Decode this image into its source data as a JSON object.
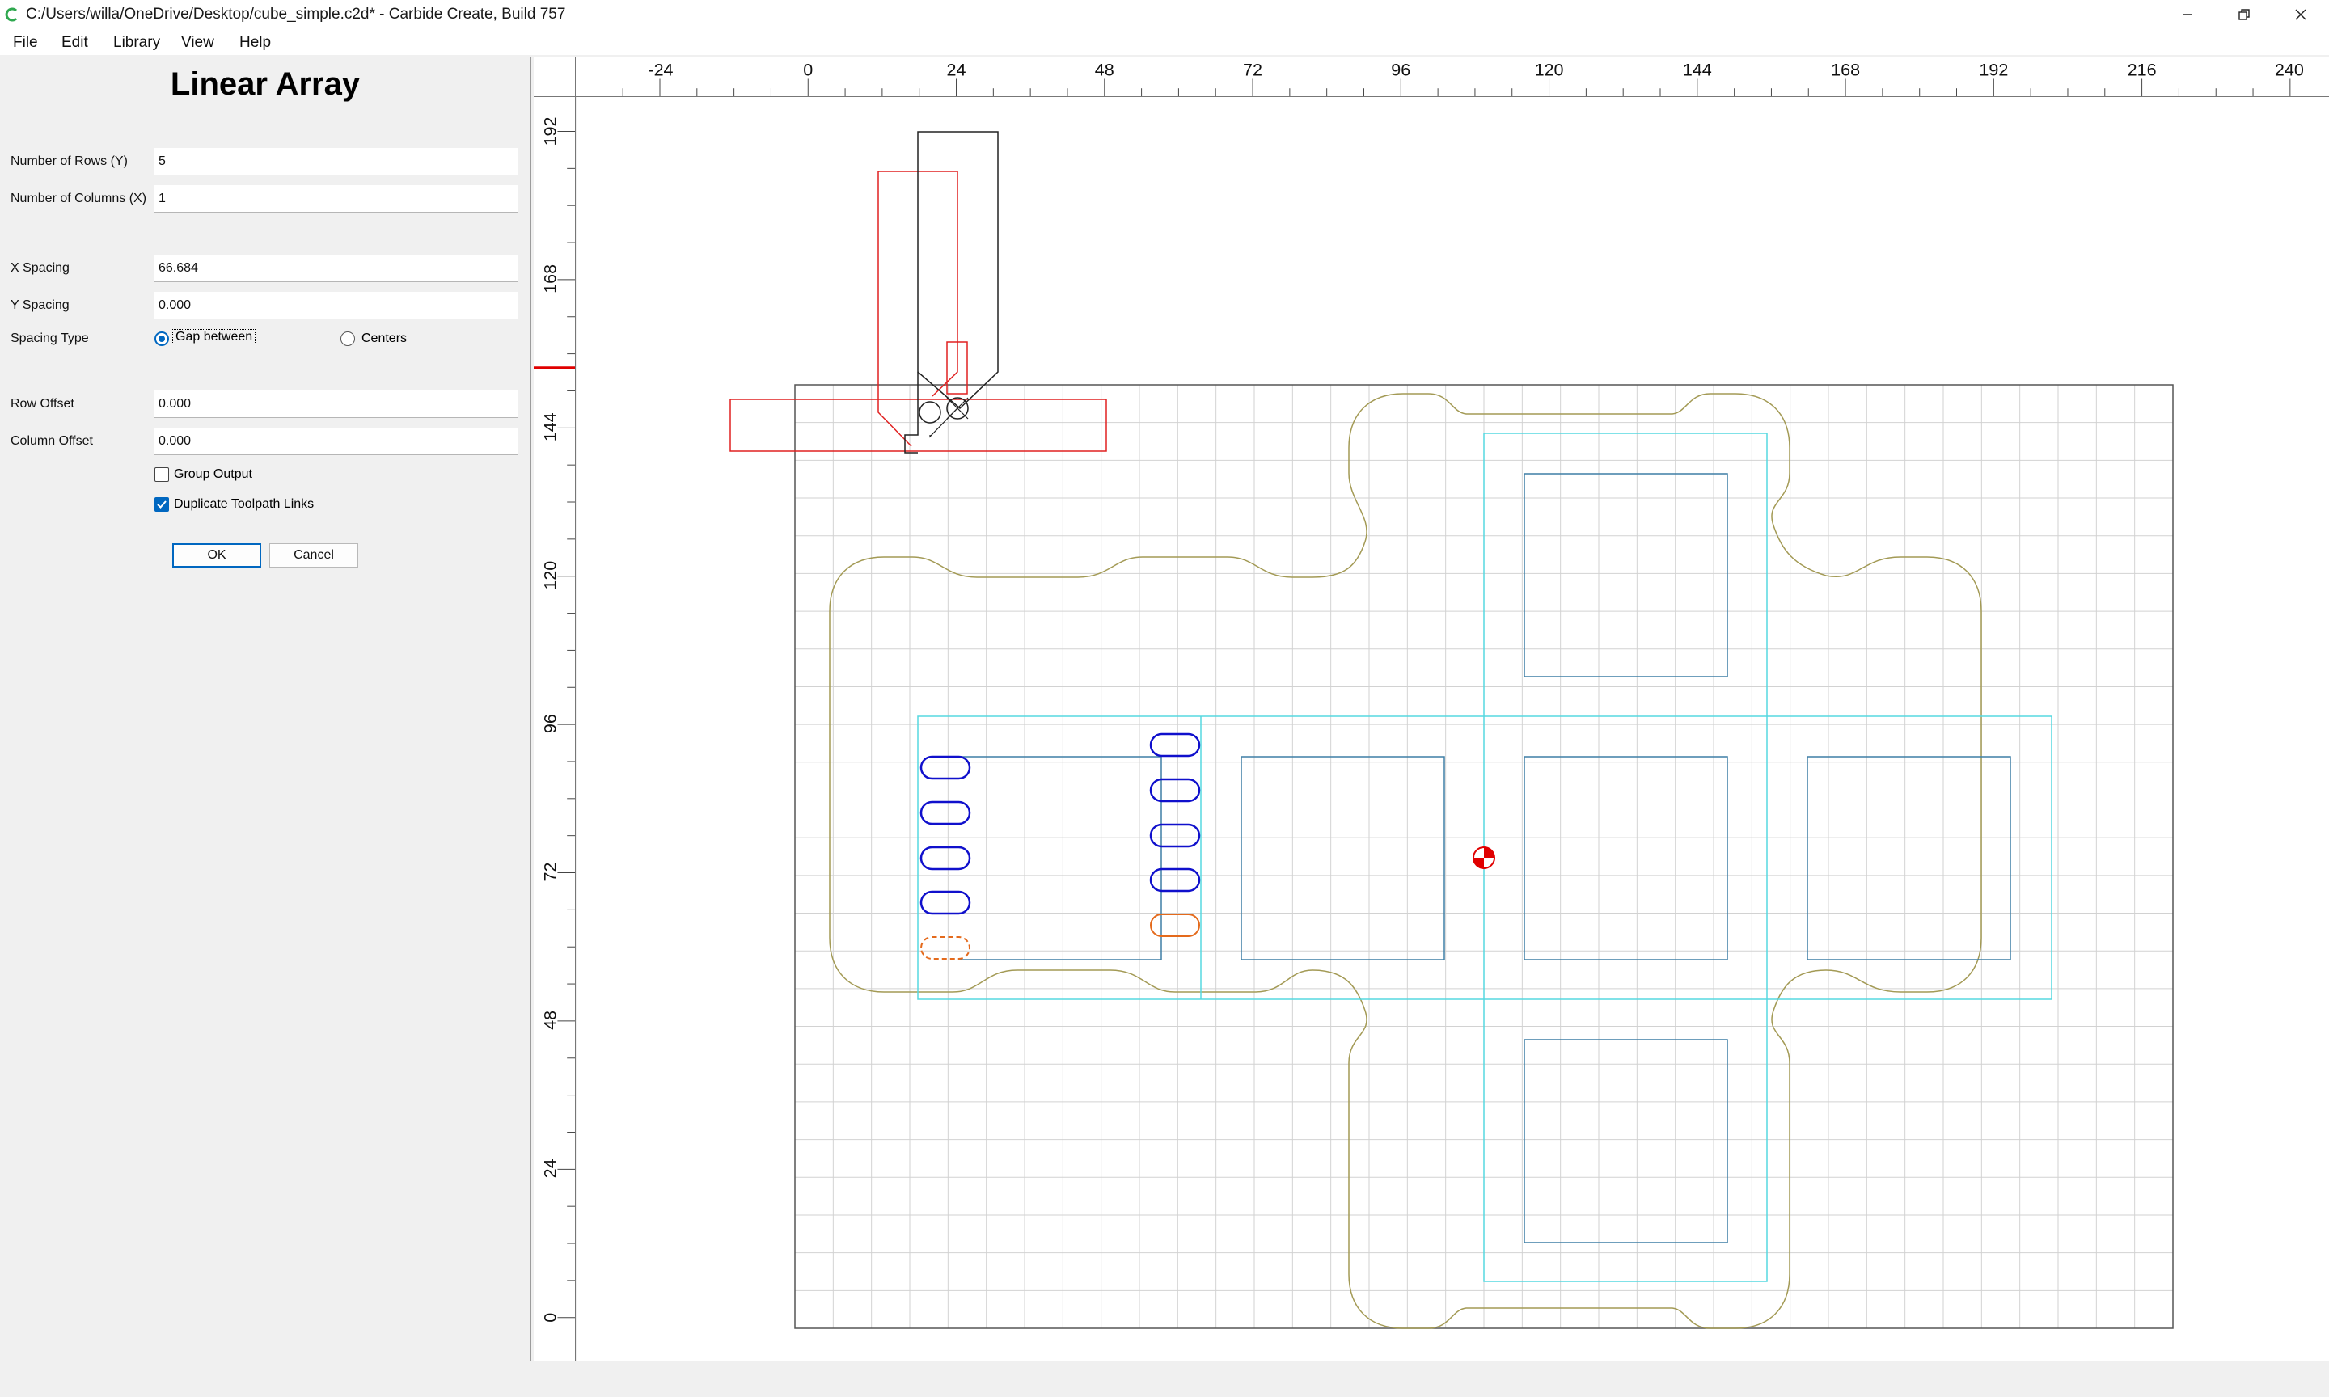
{
  "window": {
    "title": "C:/Users/willa/OneDrive/Desktop/cube_simple.c2d* - Carbide Create, Build 757",
    "icon": "carbide-create-logo-icon",
    "controls": [
      "minimize-icon",
      "restore-icon",
      "close-icon"
    ]
  },
  "menu": {
    "file": "File",
    "edit": "Edit",
    "library": "Library",
    "view": "View",
    "help": "Help"
  },
  "dialog": {
    "title": "Linear Array",
    "rows_label": "Number of Rows (Y)",
    "rows_value": "5",
    "cols_label": "Number of Columns (X)",
    "cols_value": "1",
    "xspacing_label": "X Spacing",
    "xspacing_value": "66.684",
    "yspacing_label": "Y Spacing",
    "yspacing_value": "0.000",
    "spacing_type_label": "Spacing Type",
    "spacing_option_gap": "Gap between",
    "spacing_option_centers": "Centers",
    "spacing_selected": "Gap between",
    "row_offset_label": "Row Offset",
    "row_offset_value": "0.000",
    "col_offset_label": "Column Offset",
    "col_offset_value": "0.000",
    "group_output_label": "Group Output",
    "group_output_checked": false,
    "duplicate_links_label": "Duplicate Toolpath Links",
    "duplicate_links_checked": true,
    "ok_label": "OK",
    "cancel_label": "Cancel"
  },
  "rulers": {
    "horizontal_labels": [
      "-24",
      "0",
      "24",
      "48",
      "72",
      "96",
      "120",
      "144",
      "168",
      "192",
      "216",
      "240"
    ],
    "vertical_labels": [
      "192",
      "168",
      "144",
      "120",
      "96",
      "72",
      "48",
      "24",
      "0"
    ]
  },
  "canvas": {
    "colors": {
      "grid": "#d2d2d2",
      "stock_border": "#555555",
      "outer_outline": "#a39a55",
      "inner_rect": "#56d8e0",
      "square": "#3f7fa5",
      "selected_slot": "#1010cc",
      "highlight_slot": "#e46a1c",
      "tool": "#e02020",
      "toolholder": "#222222",
      "origin_marker": "#e00000"
    }
  }
}
